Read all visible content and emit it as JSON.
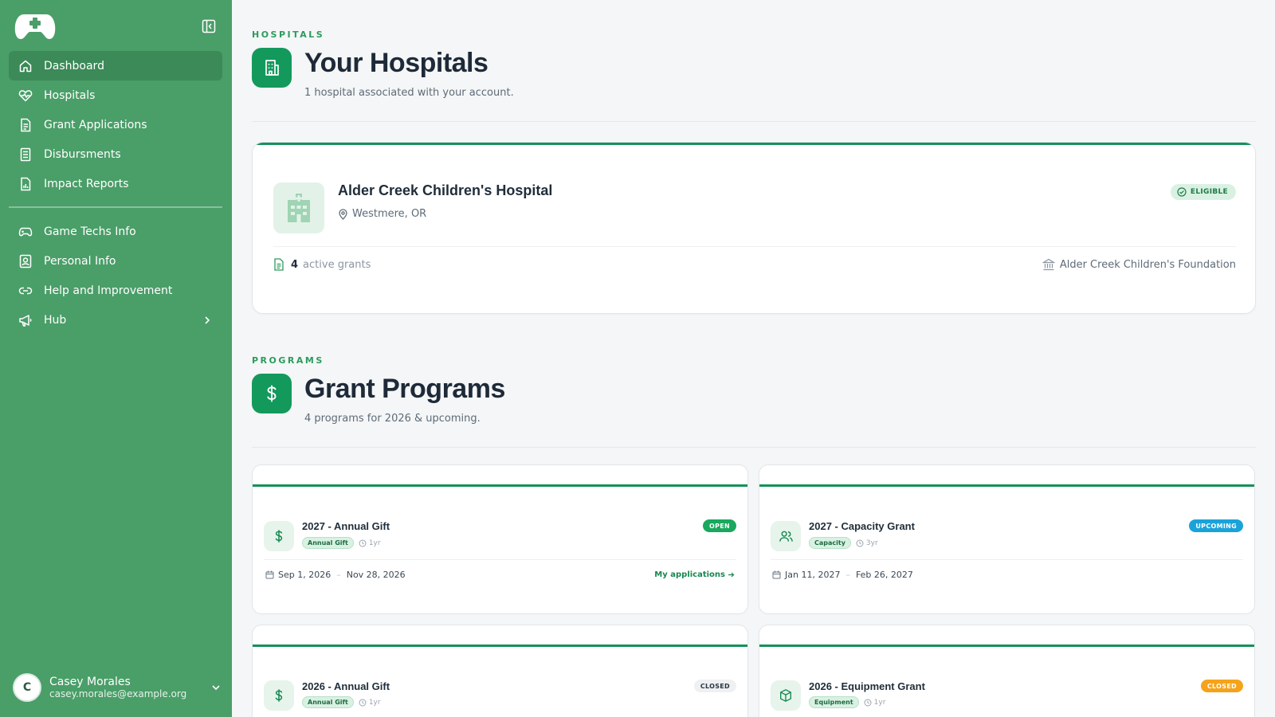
{
  "sidebar": {
    "nav": [
      {
        "label": "Dashboard",
        "icon": "home-icon",
        "active": true
      },
      {
        "label": "Hospitals",
        "icon": "heart-pulse-icon"
      },
      {
        "label": "Grant Applications",
        "icon": "document-icon"
      },
      {
        "label": "Disbursments",
        "icon": "receipt-icon"
      },
      {
        "label": "Impact Reports",
        "icon": "report-icon"
      }
    ],
    "nav2": [
      {
        "label": "Game Techs Info",
        "icon": "gamepad-icon"
      },
      {
        "label": "Personal Info",
        "icon": "id-card-icon"
      },
      {
        "label": "Help and Improvement",
        "icon": "link-icon"
      },
      {
        "label": "Hub",
        "icon": "megaphone-icon"
      }
    ],
    "user": {
      "initial": "C",
      "name": "Casey Morales",
      "email": "casey.morales@example.org"
    }
  },
  "hospitals": {
    "eyebrow": "HOSPITALS",
    "title": "Your Hospitals",
    "subtitle": "1 hospital associated with your account.",
    "card": {
      "name": "Alder Creek Children's Hospital",
      "location": "Westmere, OR",
      "status": "ELIGIBLE",
      "active_grants_count": "4",
      "active_grants_label": "active grants",
      "foundation": "Alder Creek Children's Foundation"
    }
  },
  "programs": {
    "eyebrow": "PROGRAMS",
    "title": "Grant Programs",
    "subtitle": "4 programs for 2026 & upcoming.",
    "items": [
      {
        "title": "2027 - Annual Gift",
        "tag": "Annual Gift",
        "duration": "1yr",
        "status": "OPEN",
        "start": "Sep 1, 2026",
        "end": "Nov 28, 2026",
        "link": "My applications",
        "icon": "dollar-icon"
      },
      {
        "title": "2027 - Capacity Grant",
        "tag": "Capacity",
        "duration": "3yr",
        "status": "UPCOMING",
        "start": "Jan 11, 2027",
        "end": "Feb 26, 2027",
        "icon": "users-icon"
      },
      {
        "title": "2026 - Annual Gift",
        "tag": "Annual Gift",
        "duration": "1yr",
        "status": "CLOSED",
        "icon": "dollar-icon"
      },
      {
        "title": "2026 - Equipment Grant",
        "tag": "Equipment",
        "duration": "1yr",
        "status": "CLOSED",
        "icon": "box-icon"
      }
    ]
  },
  "colors": {
    "sidebar": "#4a9e68",
    "accent": "#14915a",
    "open": "#19a85e",
    "upcoming": "#1aa3d9",
    "closed_orange": "#f5a31a"
  }
}
